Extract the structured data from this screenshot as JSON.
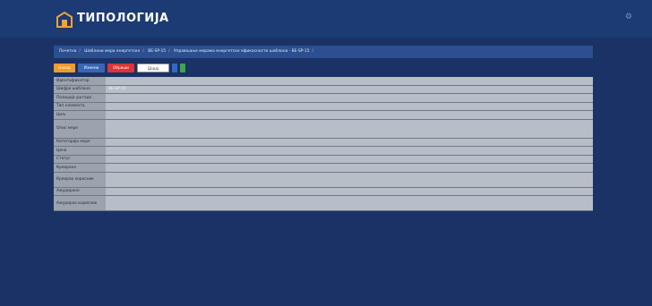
{
  "header": {
    "title": "ТИПОЛОГИЈА",
    "subtitle": "",
    "settings_icon": "gear-icon"
  },
  "breadcrumb": {
    "items": [
      "Почетна",
      "Шаблони мера енергетске",
      "BE-SP-15",
      "Управљање мерама енергетске ефикасности шаблона - BE-SP-15"
    ],
    "last": ""
  },
  "toolbar": {
    "back": "Назад",
    "edit": "Измени",
    "delete": "Обриши",
    "add_action": "Додај акцију",
    "icon1": "box-icon",
    "icon2": "check-icon"
  },
  "details": [
    {
      "label": "Идентификатор",
      "value": ""
    },
    {
      "label": "Шифра шаблона",
      "value": "BE-SP-15"
    },
    {
      "label": "Позиција уштеде",
      "value": ""
    },
    {
      "label": "Тип елемента",
      "value": ""
    },
    {
      "label": "Циљ",
      "value": ""
    },
    {
      "label": "Опис мере",
      "value": ""
    },
    {
      "label": "Категорија мере",
      "value": ""
    },
    {
      "label": "Цена",
      "value": ""
    },
    {
      "label": "Статус",
      "value": ""
    },
    {
      "label": "Креирано",
      "value": ""
    },
    {
      "label": "Креирао корисник",
      "value": ""
    },
    {
      "label": "Ажурирано",
      "value": ""
    },
    {
      "label": "Ажурирао корисник",
      "value": ""
    }
  ]
}
